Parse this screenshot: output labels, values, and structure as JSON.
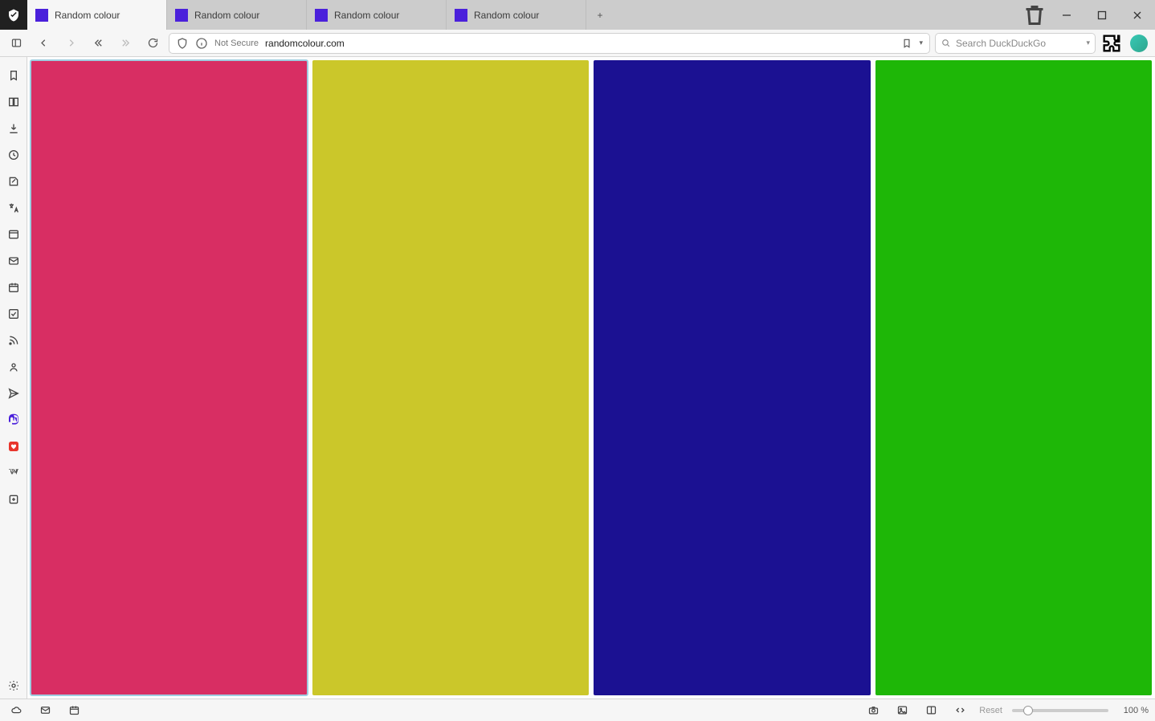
{
  "tabs": [
    {
      "title": "Random colour",
      "favicon_color": "#4a20db",
      "active": true
    },
    {
      "title": "Random colour",
      "favicon_color": "#4a20db",
      "active": false
    },
    {
      "title": "Random colour",
      "favicon_color": "#4a20db",
      "active": false
    },
    {
      "title": "Random colour",
      "favicon_color": "#4a20db",
      "active": false
    }
  ],
  "newtab_glyph": "+",
  "addressbar": {
    "not_secure_label": "Not Secure",
    "url": "randomcolour.com",
    "search_placeholder": "Search DuckDuckGo"
  },
  "side_panel_items": [
    "panels-toggle",
    "bookmarks",
    "reading-list",
    "downloads",
    "history",
    "notes",
    "translate",
    "window-panel",
    "mail",
    "calendar",
    "tasks",
    "feeds",
    "contacts",
    "send",
    "mastodon",
    "vivaldi",
    "wikipedia",
    "add-panel"
  ],
  "tiles": [
    {
      "color": "#d82e63",
      "active": true
    },
    {
      "color": "#cbc72a",
      "active": false
    },
    {
      "color": "#1b1192",
      "active": false
    },
    {
      "color": "#1eb707",
      "active": false
    }
  ],
  "statusbar": {
    "reset_label": "Reset",
    "zoom_label": "100 %"
  }
}
